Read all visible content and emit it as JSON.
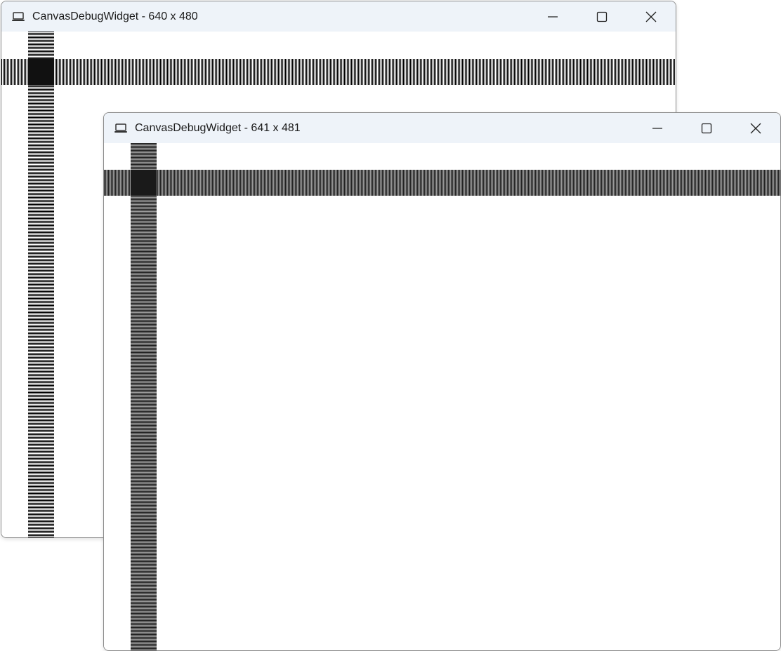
{
  "windows": {
    "back": {
      "title": "CanvasDebugWidget - 640 x 480",
      "icon": "laptop-icon",
      "buttons": [
        "minimize-icon",
        "maximize-icon",
        "close-icon"
      ]
    },
    "front": {
      "title": "CanvasDebugWidget - 641 x 481",
      "icon": "laptop-icon",
      "buttons": [
        "minimize-icon",
        "maximize-icon",
        "close-icon"
      ]
    }
  },
  "colors": {
    "titlebar": "#eef3f9",
    "stripe_dark": "#000000",
    "border": "#8a8a8a"
  }
}
